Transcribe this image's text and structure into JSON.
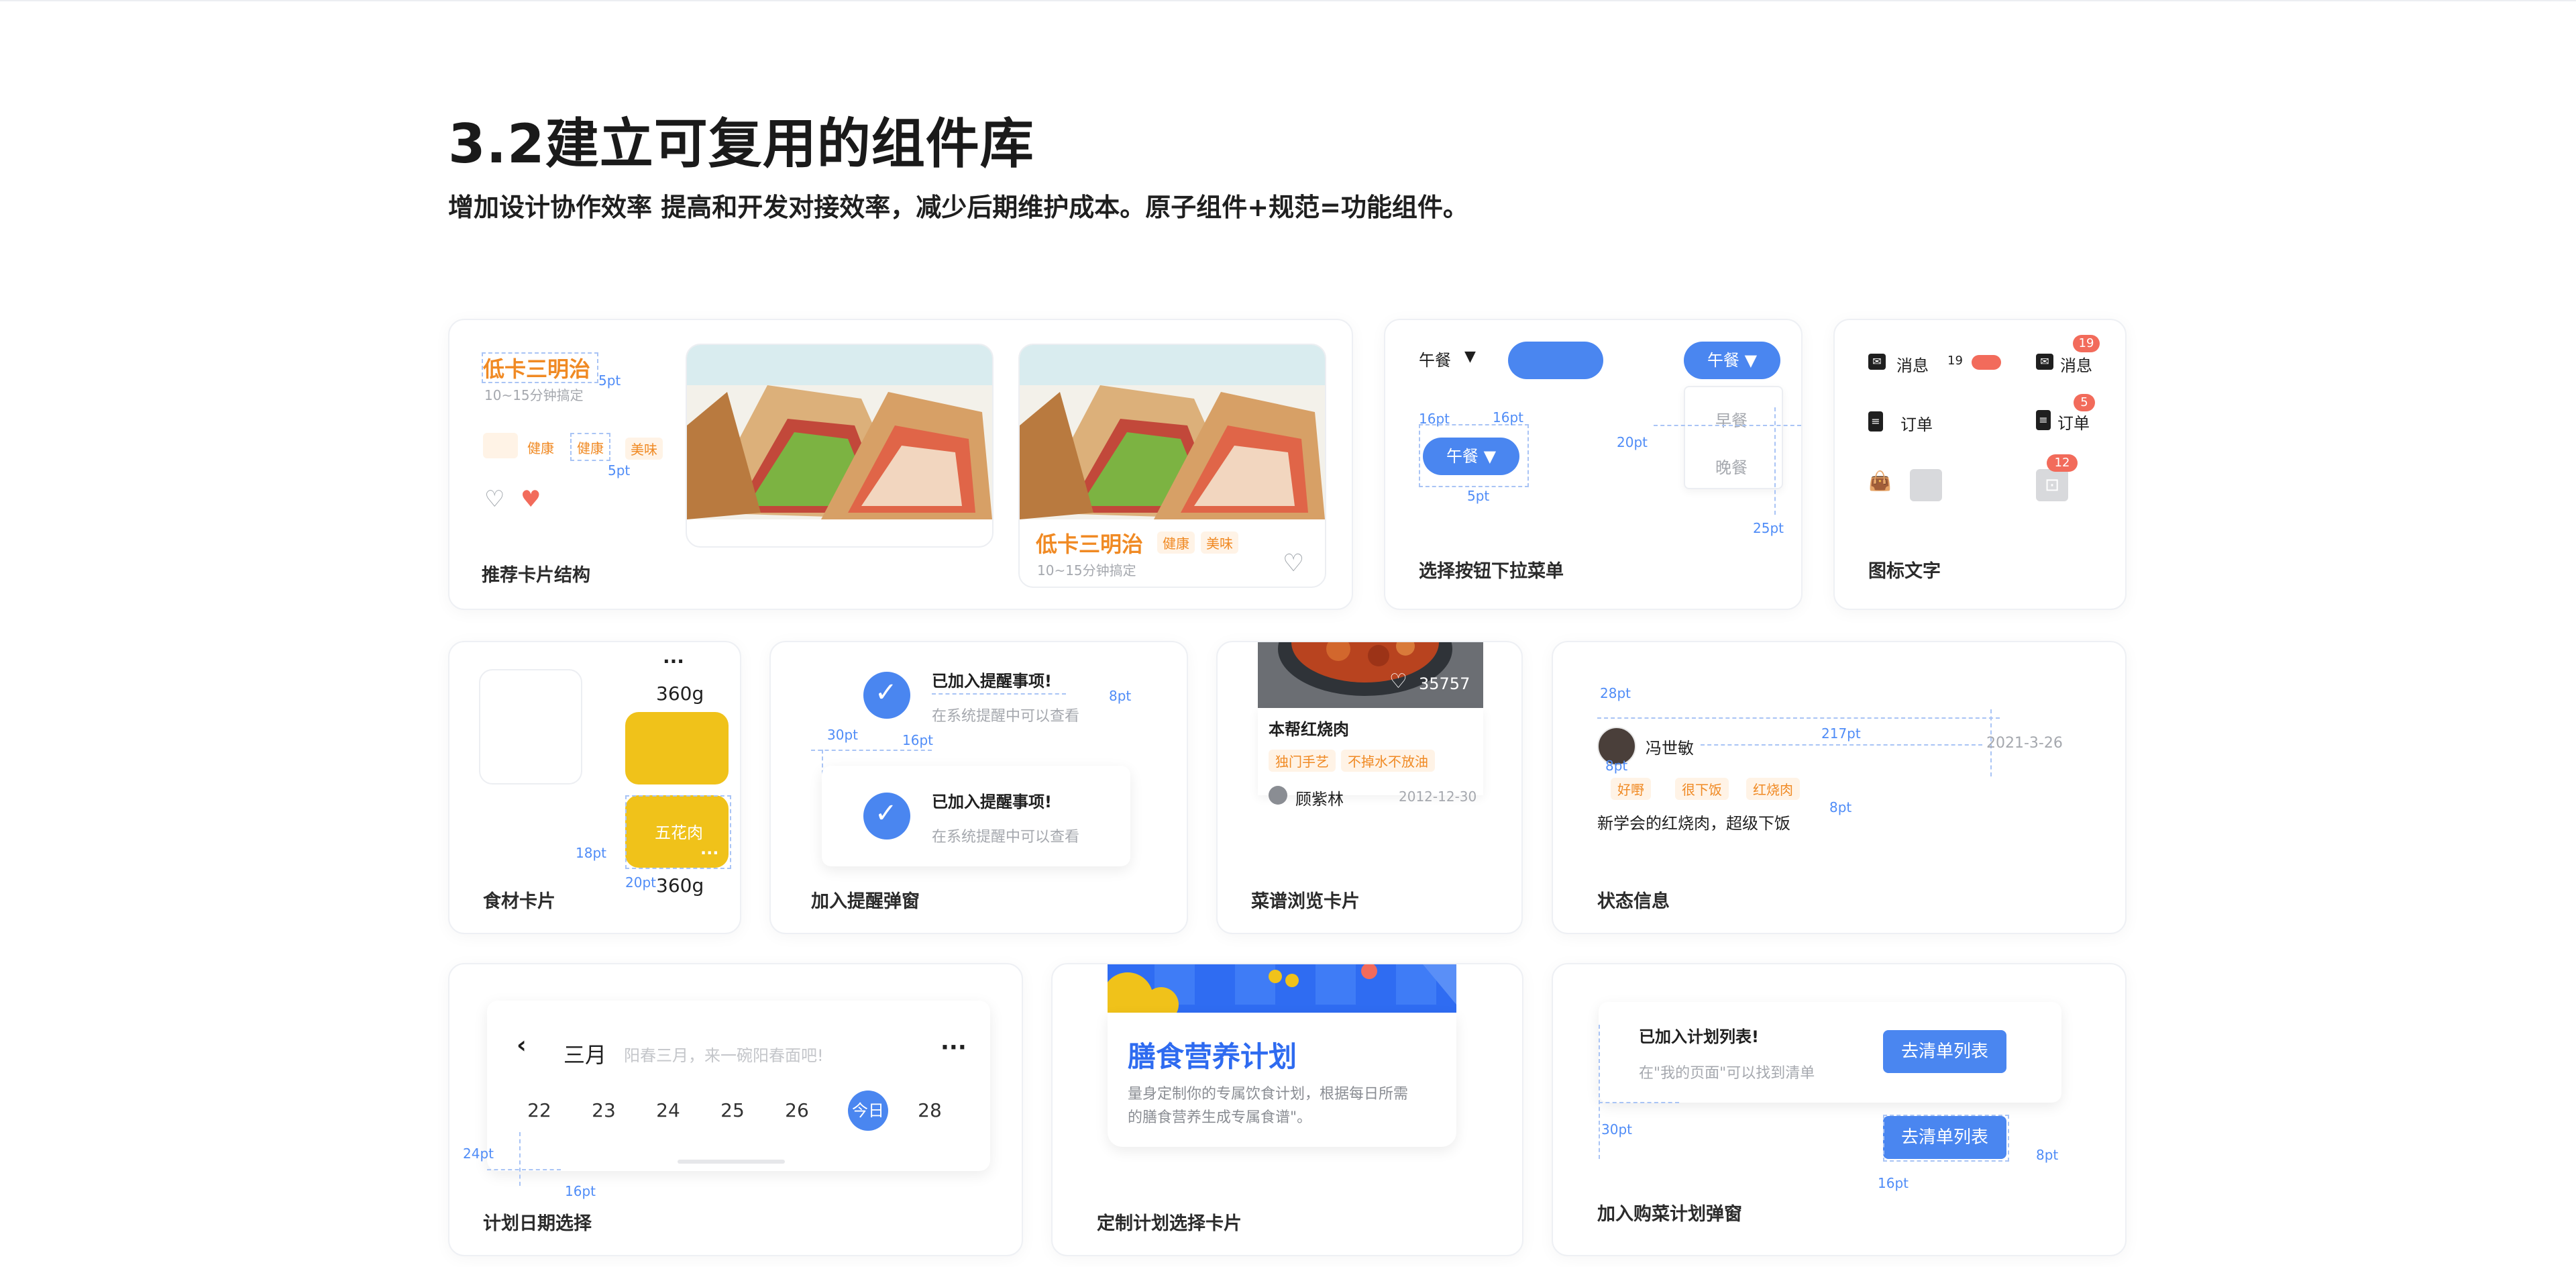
{
  "header": {
    "title": "3.2建立可复用的组件库",
    "subtitle": "增加设计协作效率  提高和开发对接效率，减少后期维护成本。原子组件+规范=功能组件。"
  },
  "colors": {
    "accent": "#4a86f0",
    "orange": "#f08a24",
    "yellow": "#f0c21a",
    "red": "#f26b5b"
  },
  "card1": {
    "caption": "推荐卡片结构",
    "name": "低卡三明治",
    "time": "10~15分钟搞定",
    "tag_a": "健康",
    "tag_b": "健康",
    "tag_c": "美味",
    "ann_a": "5pt",
    "ann_b": "5pt",
    "preview_name": "低卡三明治",
    "preview_tag_a": "健康",
    "preview_tag_b": "美味",
    "preview_time": "10~15分钟搞定"
  },
  "card2": {
    "caption": "选择按钮下拉菜单",
    "label": "午餐",
    "arrow": "▼",
    "selected": "午餐",
    "selected_small": "午餐",
    "option_1": "早餐",
    "option_2": "晚餐",
    "ann_16a": "16pt",
    "ann_16b": "16pt",
    "ann_20": "20pt",
    "ann_5": "5pt",
    "ann_25": "25pt"
  },
  "card3": {
    "caption": "图标文字",
    "msg": "消息",
    "msg_count": "19",
    "msg_b": "消息",
    "badge_msg": "19",
    "order": "订单",
    "order_b": "订单",
    "badge_order": "5",
    "badge_bag": "12"
  },
  "card4": {
    "caption": "食材卡片",
    "more": "···",
    "weight_top": "360g",
    "item": "五花肉",
    "weight_bottom": "360g",
    "ann_18": "18pt",
    "ann_20": "20pt"
  },
  "card5": {
    "caption": "加入提醒弹窗",
    "title": "已加入提醒事项!",
    "desc": "在系统提醒中可以查看",
    "title2": "已加入提醒事项!",
    "desc2": "在系统提醒中可以查看",
    "ann_8": "8pt",
    "ann_30": "30pt",
    "ann_16": "16pt"
  },
  "card6": {
    "caption": "菜谱浏览卡片",
    "likes": "35757",
    "dish": "本帮红烧肉",
    "tag_a": "独门手艺",
    "tag_b": "不掉水不放油",
    "author": "顾紫林",
    "date": "2012-12-30"
  },
  "card7": {
    "caption": "状态信息",
    "user": "冯世敏",
    "date": "2021-3-26",
    "tag_a": "好嘢",
    "tag_b": "很下饭",
    "tag_c": "红烧肉",
    "comment": "新学会的红烧肉，超级下饭",
    "ann_28": "28pt",
    "ann_217": "217pt",
    "ann_8a": "8pt",
    "ann_8b": "8pt"
  },
  "card8": {
    "caption": "计划日期选择",
    "month": "三月",
    "hint": "阳春三月，来一碗阳春面吧!",
    "more": "···",
    "days": [
      "22",
      "23",
      "24",
      "25",
      "26",
      "今日",
      "28"
    ],
    "ann_24": "24pt",
    "ann_16": "16pt"
  },
  "card9": {
    "caption": "定制计划选择卡片",
    "title": "膳食营养计划",
    "desc_1": "量身定制你的专属饮食计划，根据每日所需",
    "desc_2": "的膳食营养生成专属食谱\"。"
  },
  "card10": {
    "caption": "加入购菜计划弹窗",
    "title": "已加入计划列表!",
    "desc": "在\"我的页面\"可以找到清单",
    "button": "去清单列表",
    "button2": "去清单列表",
    "ann_30": "30pt",
    "ann_16": "16pt",
    "ann_8": "8pt"
  }
}
